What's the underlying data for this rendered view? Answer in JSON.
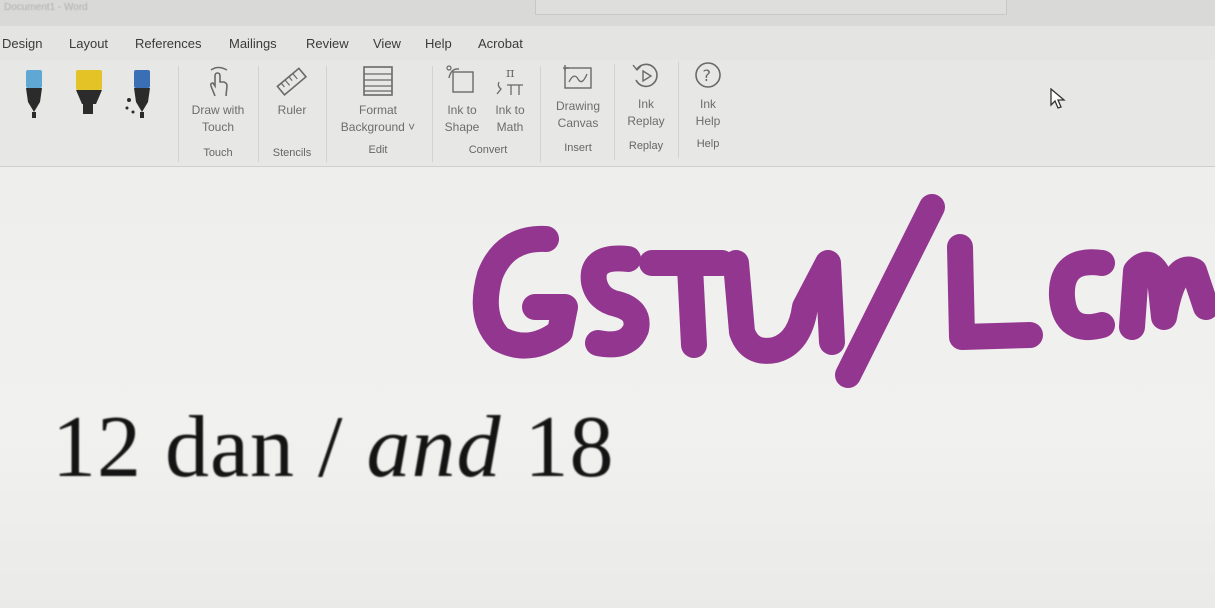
{
  "window": {
    "title": "Document1 - Word"
  },
  "menu": {
    "items": [
      "Design",
      "Layout",
      "References",
      "Mailings",
      "Review",
      "View",
      "Help",
      "Acrobat"
    ]
  },
  "ribbon": {
    "pens": [
      {
        "name": "pen-blue",
        "color": "#5fa8d3"
      },
      {
        "name": "highlighter-yellow",
        "color": "#e3c326"
      },
      {
        "name": "pen-galaxy",
        "color": "#3a6fb5"
      }
    ],
    "touch": {
      "draw_with_touch_line1": "Draw with",
      "draw_with_touch_line2": "Touch",
      "group_label": "Touch"
    },
    "stencils": {
      "ruler": "Ruler",
      "group_label": "Stencils"
    },
    "edit": {
      "format_background_line1": "Format",
      "format_background_line2": "Background ˅",
      "group_label": "Edit"
    },
    "convert": {
      "ink_to_shape_line1": "Ink to",
      "ink_to_shape_line2": "Shape",
      "ink_to_math_line1": "Ink to",
      "ink_to_math_line2": "Math",
      "group_label": "Convert"
    },
    "insert": {
      "drawing_canvas_line1": "Drawing",
      "drawing_canvas_line2": "Canvas",
      "group_label": "Insert"
    },
    "replay": {
      "ink_replay_line1": "Ink",
      "ink_replay_line2": "Replay",
      "group_label": "Replay"
    },
    "help": {
      "ink_help_line1": "Ink",
      "ink_help_line2": "Help",
      "group_label": "Help"
    }
  },
  "document": {
    "handwriting": "GSTU/LCM",
    "handwriting_color": "#93368f",
    "body_text_part1": "12 dan / ",
    "body_text_italic": "and",
    "body_text_part2": " 18"
  }
}
